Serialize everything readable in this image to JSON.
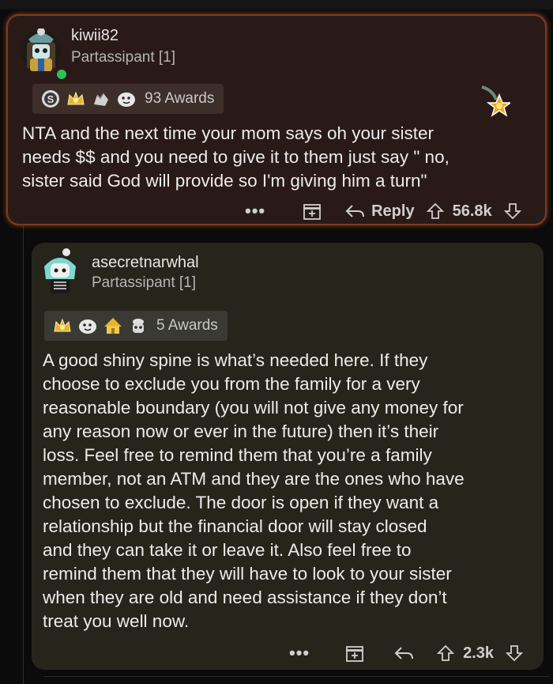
{
  "comments": [
    {
      "username": "kiwii82",
      "flair": "Partassipant [1]",
      "online": true,
      "awards": {
        "icons": [
          "silver-coin-icon",
          "gold-crown-icon",
          "wholesome-hands-icon",
          "ghost-smile-icon"
        ],
        "count_label": "93 Awards"
      },
      "featured_award_icon": "star-award-icon",
      "body": "NTA and the next time your mom says oh your sister\nneeds $$ and you need to give it to them just say \" no,\nsister said God will provide so I'm giving him a turn\"",
      "actions": {
        "more": "•••",
        "reply_label": "Reply",
        "score": "56.8k"
      }
    },
    {
      "username": "asecretnarwhal",
      "flair": "Partassipant [1]",
      "awards": {
        "icons": [
          "gold-crown-icon",
          "ghost-smile-icon",
          "gold-house-icon",
          "helper-bot-icon"
        ],
        "count_label": "5 Awards"
      },
      "body": "A good shiny spine is what’s needed here. If they\nchoose to exclude you from the family for a very\nreasonable boundary (you will not give any money for\nany reason now or ever in the future) then it’s their\nloss. Feel free to remind them that you’re a family\nmember, not an ATM and they are the ones who have\nchosen to exclude. The door is open if they want a\nrelationship but the financial door will stay closed\nand they can take it or leave it. Also feel free to\nremind them that they will have to look to your sister\nwhen they are old and need assistance if they don’t\ntreat you well now.",
      "actions": {
        "more": "•••",
        "score": "2.3k"
      }
    }
  ],
  "colors": {
    "card1_bg": "#2a1a17",
    "card1_border": "#7a3b22",
    "card2_bg": "#26251c",
    "text": "#ececec",
    "muted": "#b5b5b5"
  }
}
